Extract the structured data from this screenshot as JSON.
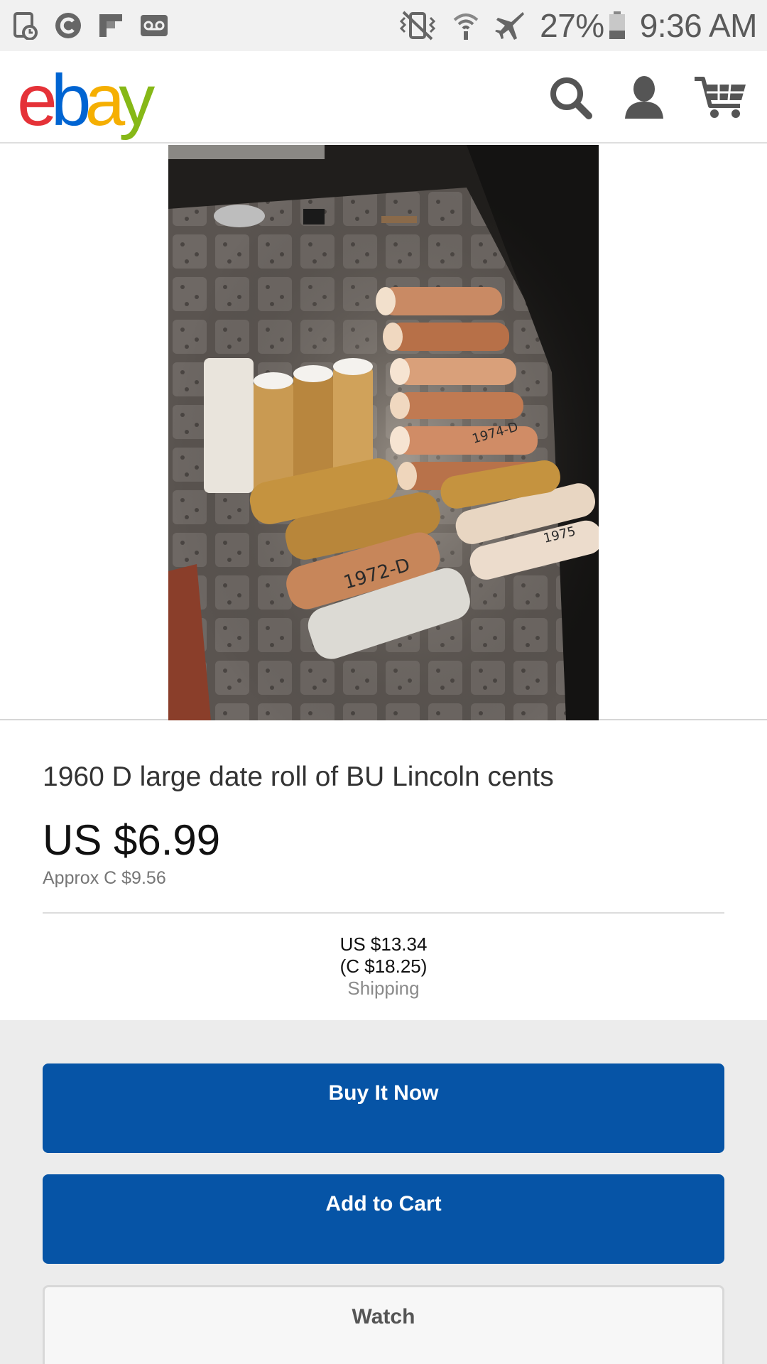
{
  "status_bar": {
    "battery": "27%",
    "time": "9:36 AM"
  },
  "header": {
    "logo": {
      "e": "e",
      "b": "b",
      "a": "a",
      "y": "y"
    },
    "icons": [
      "search-icon",
      "account-icon",
      "cart-icon"
    ]
  },
  "product": {
    "title": "1960 D large date roll of BU Lincoln cents",
    "price": "US $6.99",
    "approx": "Approx C $9.56",
    "shipping": {
      "us": "US $13.34",
      "cad": "(C $18.25)",
      "label": "Shipping"
    },
    "roll_labels": [
      "1972-D",
      "1974-D",
      "1975"
    ]
  },
  "actions": {
    "buy_now": "Buy It Now",
    "add_to_cart": "Add to Cart",
    "watch": "Watch"
  },
  "colors": {
    "primary_button": "#0654a6",
    "logo_red": "#e53238",
    "logo_blue": "#0064d2",
    "logo_yellow": "#f5af02",
    "logo_green": "#86b817"
  }
}
